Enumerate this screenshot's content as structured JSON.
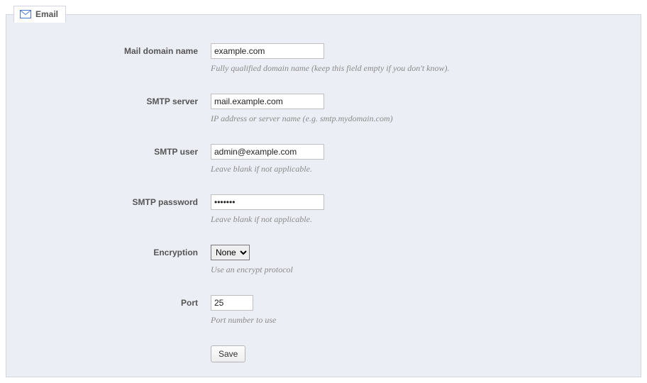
{
  "tab": {
    "label": "Email"
  },
  "fields": {
    "domain": {
      "label": "Mail domain name",
      "value": "example.com",
      "hint": "Fully qualified domain name (keep this field empty if you don't know)."
    },
    "smtp_server": {
      "label": "SMTP server",
      "value": "mail.example.com",
      "hint": "IP address or server name (e.g. smtp.mydomain.com)"
    },
    "smtp_user": {
      "label": "SMTP user",
      "value": "admin@example.com",
      "hint": "Leave blank if not applicable."
    },
    "smtp_password": {
      "label": "SMTP password",
      "value": "•••••••",
      "hint": "Leave blank if not applicable."
    },
    "encryption": {
      "label": "Encryption",
      "selected": "None",
      "hint": "Use an encrypt protocol"
    },
    "port": {
      "label": "Port",
      "value": "25",
      "hint": "Port number to use"
    }
  },
  "buttons": {
    "save": "Save"
  }
}
